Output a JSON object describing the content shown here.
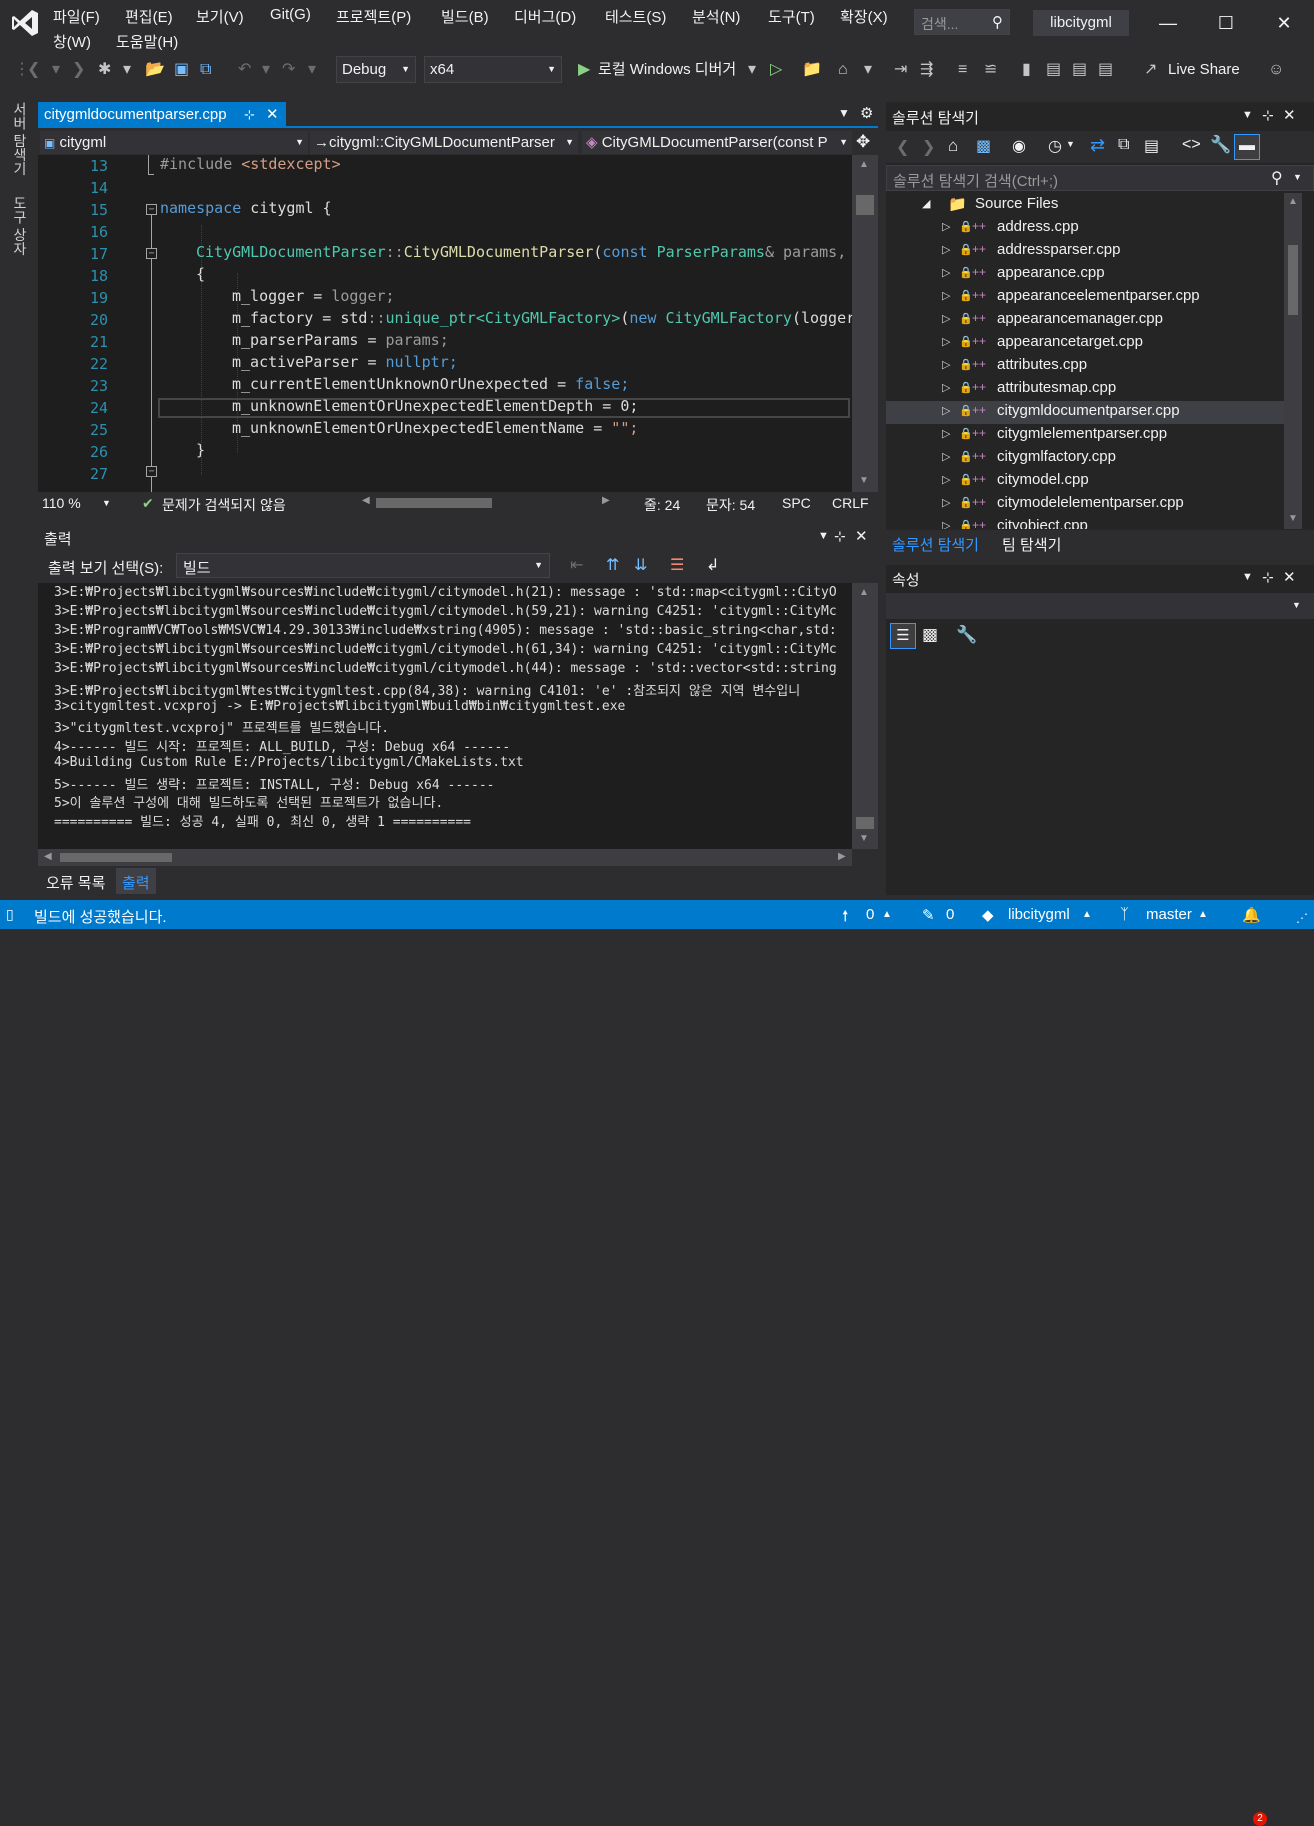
{
  "menu": {
    "items": [
      "파일(F)",
      "편집(E)",
      "보기(V)",
      "Git(G)",
      "프로젝트(P)",
      "빌드(B)",
      "디버그(D)",
      "테스트(S)",
      "분석(N)",
      "도구(T)",
      "확장(X)"
    ],
    "items_row2": [
      "창(W)",
      "도움말(H)"
    ],
    "search_placeholder": "검색...",
    "solution_name": "libcitygml"
  },
  "toolbar": {
    "config": "Debug",
    "platform": "x64",
    "run_label": "로컬 Windows 디버거",
    "live_share": "Live Share"
  },
  "left_tabs": [
    "서버 탐색기",
    "도구 상자"
  ],
  "editor": {
    "tab_title": "citygmldocumentparser.cpp",
    "nav_project": "citygml",
    "nav_class": "citygml::CityGMLDocumentParser",
    "nav_member": "CityGMLDocumentParser(const P",
    "line_numbers": [
      "13",
      "14",
      "15",
      "16",
      "17",
      "18",
      "19",
      "20",
      "21",
      "22",
      "23",
      "24",
      "25",
      "26",
      "27"
    ],
    "zoom": "110 %",
    "issues": "문제가 검색되지 않음",
    "line": "줄: 24",
    "col": "문자: 54",
    "spc": "SPC",
    "crlf": "CRLF"
  },
  "code": {
    "l13_a": "#include ",
    "l13_b": "<stdexcept>",
    "l15_a": "namespace",
    "l15_b": " citygml {",
    "l17_a": "CityGMLDocumentParser",
    "l17_b": "::",
    "l17_c": "CityGMLDocumentParser",
    "l17_d": "(",
    "l17_e": "const",
    "l17_f": " ParserParams",
    "l17_g": "& params, s",
    "l18": "{",
    "l19_a": "m_logger",
    "l19_b": " = ",
    "l19_c": "logger;",
    "l20_a": "m_factory",
    "l20_b": " = std",
    "l20_c": "::",
    "l20_d": "unique_ptr",
    "l20_e": "<CityGMLFactory>",
    "l20_f": "(",
    "l20_g": "new",
    "l20_h": " CityGMLFactory",
    "l20_i": "(logger)",
    "l21_a": "m_parserParams",
    "l21_b": " = ",
    "l21_c": "params;",
    "l22_a": "m_activeParser",
    "l22_b": " = ",
    "l22_c": "nullptr;",
    "l23_a": "m_currentElementUnknownOrUnexpected",
    "l23_b": " = ",
    "l23_c": "false;",
    "l24_a": "m_unknownElementOrUnexpectedElementDepth",
    "l24_b": " = 0;",
    "l25_a": "m_unknownElementOrUnexpectedElementName",
    "l25_b": " = ",
    "l25_c": "\"\";",
    "l26": "}"
  },
  "output": {
    "title": "출력",
    "source_label": "출력 보기 선택(S):",
    "source_value": "빌드",
    "lines": [
      "3>E:₩Projects₩libcitygml₩sources₩include₩citygml/citymodel.h(21): message : 'std::map<citygml::CityO",
      "3>E:₩Projects₩libcitygml₩sources₩include₩citygml/citymodel.h(59,21): warning C4251: 'citygml::CityMc",
      "3>E:₩Program₩VC₩Tools₩MSVC₩14.29.30133₩include₩xstring(4905): message : 'std::basic_string<char,std:",
      "3>E:₩Projects₩libcitygml₩sources₩include₩citygml/citymodel.h(61,34): warning C4251: 'citygml::CityMc",
      "3>E:₩Projects₩libcitygml₩sources₩include₩citygml/citymodel.h(44): message : 'std::vector<std::string",
      "3>E:₩Projects₩libcitygml₩test₩citygmltest.cpp(84,38): warning C4101: 'e' :참조되지 않은 지역 변수입니",
      "3>citygmltest.vcxproj -> E:₩Projects₩libcitygml₩build₩bin₩citygmltest.exe",
      "3>\"citygmltest.vcxproj\" 프로젝트를 빌드했습니다.",
      "4>------ 빌드 시작: 프로젝트: ALL_BUILD, 구성: Debug x64 ------",
      "4>Building Custom Rule E:/Projects/libcitygml/CMakeLists.txt",
      "5>------ 빌드 생략: 프로젝트: INSTALL, 구성: Debug x64 ------",
      "5>이 솔루션 구성에 대해 빌드하도록 선택된 프로젝트가 없습니다.",
      "========== 빌드: 성공 4, 실패 0, 최신 0, 생략 1 =========="
    ],
    "tab_errors": "오류 목록",
    "tab_output": "출력"
  },
  "solution_explorer": {
    "title": "솔루션 탐색기",
    "search_placeholder": "솔루션 탐색기 검색(Ctrl+;)",
    "folder": "Source Files",
    "files": [
      "address.cpp",
      "addressparser.cpp",
      "appearance.cpp",
      "appearanceelementparser.cpp",
      "appearancemanager.cpp",
      "appearancetarget.cpp",
      "attributes.cpp",
      "attributesmap.cpp",
      "citygmldocumentparser.cpp",
      "citygmlelementparser.cpp",
      "citygmlfactory.cpp",
      "citymodel.cpp",
      "citymodelelementparser.cpp",
      "cityobject.cpp"
    ],
    "tab_solution": "솔루션 탐색기",
    "tab_team": "팀 탐색기"
  },
  "properties": {
    "title": "속성"
  },
  "status": {
    "message": "빌드에 성공했습니다.",
    "up": "0",
    "pencil": "0",
    "repo": "libcitygml",
    "branch": "master",
    "notifications": "2"
  },
  "colors": {
    "accent": "#007acc",
    "editor_bg": "#1e1e1e",
    "chrome_bg": "#2d2d30"
  }
}
